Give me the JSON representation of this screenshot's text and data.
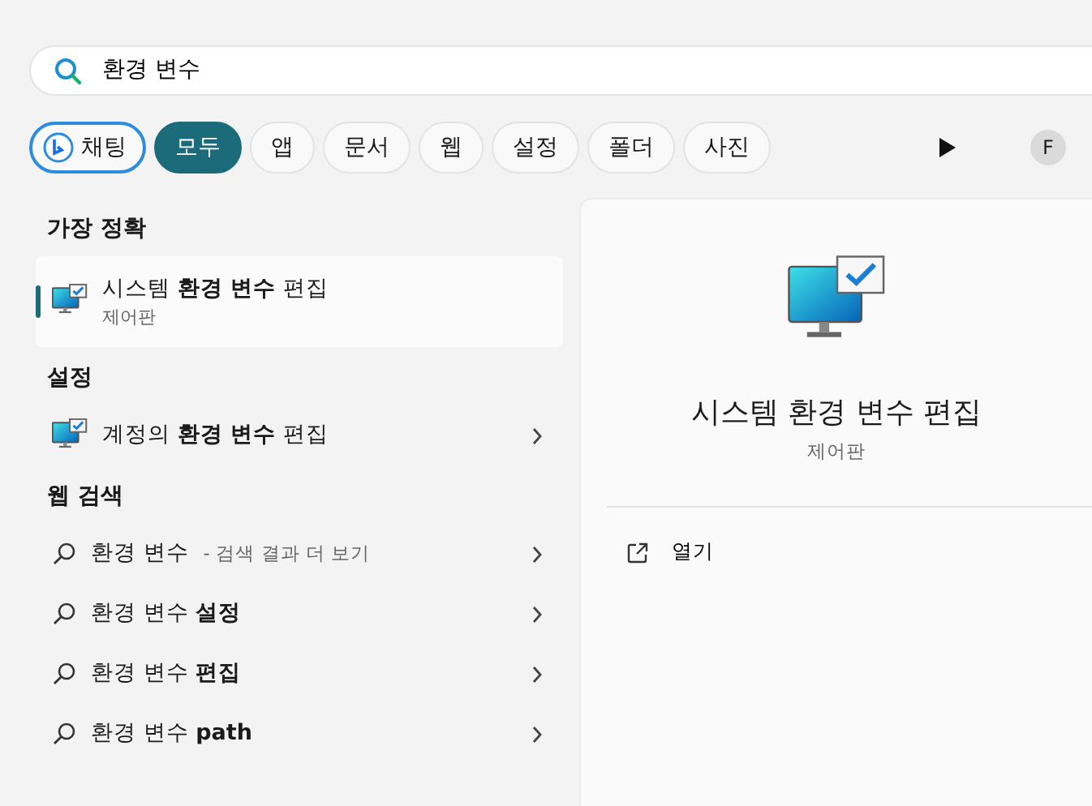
{
  "search": {
    "value": "환경 변수"
  },
  "filters": [
    {
      "label": "채팅",
      "kind": "chat",
      "selected": false
    },
    {
      "label": "모두",
      "kind": "plain",
      "selected": true
    },
    {
      "label": "앱",
      "kind": "plain",
      "selected": false
    },
    {
      "label": "문서",
      "kind": "plain",
      "selected": false
    },
    {
      "label": "웹",
      "kind": "plain",
      "selected": false
    },
    {
      "label": "설정",
      "kind": "plain",
      "selected": false
    },
    {
      "label": "폴더",
      "kind": "plain",
      "selected": false
    },
    {
      "label": "사진",
      "kind": "plain",
      "selected": false
    }
  ],
  "account": {
    "initial": "F"
  },
  "sections": [
    {
      "title": "가장 정확",
      "items": [
        {
          "kind": "app",
          "title": "시스템 **환경 변수** 편집",
          "subtitle": "제어판",
          "selected": true
        }
      ]
    },
    {
      "title": "설정",
      "items": [
        {
          "kind": "setting",
          "title": "계정의 **환경 변수** 편집",
          "selected": false
        }
      ]
    },
    {
      "title": "웹 검색",
      "items": [
        {
          "kind": "web",
          "title": "환경 변수",
          "hint": "- 검색 결과 더 보기",
          "selected": false
        },
        {
          "kind": "web",
          "title": "환경 변수 **설정**",
          "selected": false
        },
        {
          "kind": "web",
          "title": "환경 변수 **편집**",
          "selected": false
        },
        {
          "kind": "web",
          "title": "환경 변수 **path**",
          "selected": false
        }
      ]
    }
  ],
  "preview": {
    "title": "시스템 환경 변수 편집",
    "subtitle": "제어판",
    "actions": [
      {
        "label": "열기"
      }
    ]
  }
}
